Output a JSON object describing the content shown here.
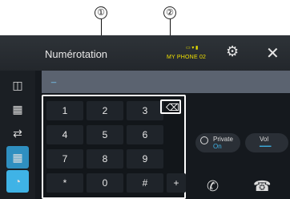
{
  "callouts": {
    "one": "①",
    "two": "②"
  },
  "header": {
    "title": "Numérotation",
    "phone_name": "MY PHONE 02",
    "status_glyphs": "▭ ▾ ▮",
    "gear_glyph": "⚙",
    "close_glyph": "✕"
  },
  "sidebar": [
    {
      "name": "contacts-icon",
      "glyph": "◫"
    },
    {
      "name": "phonebook-icon",
      "glyph": "▦"
    },
    {
      "name": "recent-calls-icon",
      "glyph": "⇄"
    },
    {
      "name": "keypad-icon",
      "glyph": "▦"
    },
    {
      "name": "voice-icon",
      "glyph": "◔"
    }
  ],
  "entry": {
    "value": "_"
  },
  "keypad": {
    "keys": [
      "1",
      "2",
      "3",
      "4",
      "5",
      "6",
      "7",
      "8",
      "9",
      "*",
      "0",
      "#",
      "+"
    ],
    "backspace_glyph": "⌫"
  },
  "right_panel": {
    "private_label": "Private",
    "private_state": "On",
    "vol_label": "Vol",
    "vol_glyph": "━━━",
    "call_glyph": "✆",
    "end_glyph": "☎"
  },
  "colors": {
    "accent": "#3fb3e6",
    "entry_bg": "#5b6370",
    "phone_name": "#f0e000"
  }
}
